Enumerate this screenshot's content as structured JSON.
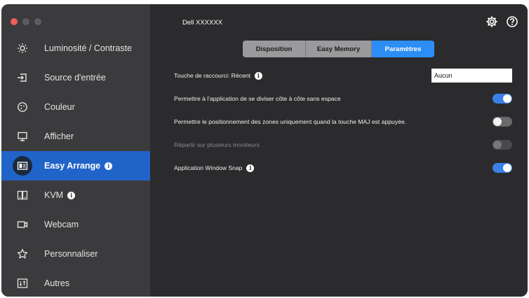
{
  "app": {
    "title": "Dell XXXXXX"
  },
  "sidebar": {
    "items": [
      {
        "label": "Luminosité / Contraste",
        "icon": "brightness-icon",
        "active": false,
        "info": false
      },
      {
        "label": "Source d'entrée",
        "icon": "input-source-icon",
        "active": false,
        "info": false
      },
      {
        "label": "Couleur",
        "icon": "color-icon",
        "active": false,
        "info": false
      },
      {
        "label": "Afficher",
        "icon": "display-icon",
        "active": false,
        "info": false
      },
      {
        "label": "Easy Arrange",
        "icon": "easy-arrange-icon",
        "active": true,
        "info": true
      },
      {
        "label": "KVM",
        "icon": "kvm-icon",
        "active": false,
        "info": true
      },
      {
        "label": "Webcam",
        "icon": "webcam-icon",
        "active": false,
        "info": false
      },
      {
        "label": "Personnaliser",
        "icon": "star-icon",
        "active": false,
        "info": false
      },
      {
        "label": "Autres",
        "icon": "others-icon",
        "active": false,
        "info": false
      }
    ]
  },
  "tabs": [
    {
      "label": "Disposition",
      "selected": false
    },
    {
      "label": "Easy Memory",
      "selected": false
    },
    {
      "label": "Paramètres",
      "selected": true
    }
  ],
  "settings": {
    "shortcut_label": "Touche de raccourci: Récent",
    "shortcut_value": "Aucun",
    "split_label": "Permettre à l'application de se diviser côte à côte sans espace",
    "split_on": true,
    "shift_label": "Permettre le positionnement des zones uniquement quand la touche MAJ est appuyée.",
    "shift_on": false,
    "multi_label": "Répartir sur plusieurs moniteurs",
    "multi_on": false,
    "snap_label": "Application Window Snap",
    "snap_on": true
  },
  "colors": {
    "accent": "#2164c9",
    "toggle_on": "#3b80e8",
    "tab_selected": "#2c8ef5",
    "close": "#ec5f5d"
  }
}
